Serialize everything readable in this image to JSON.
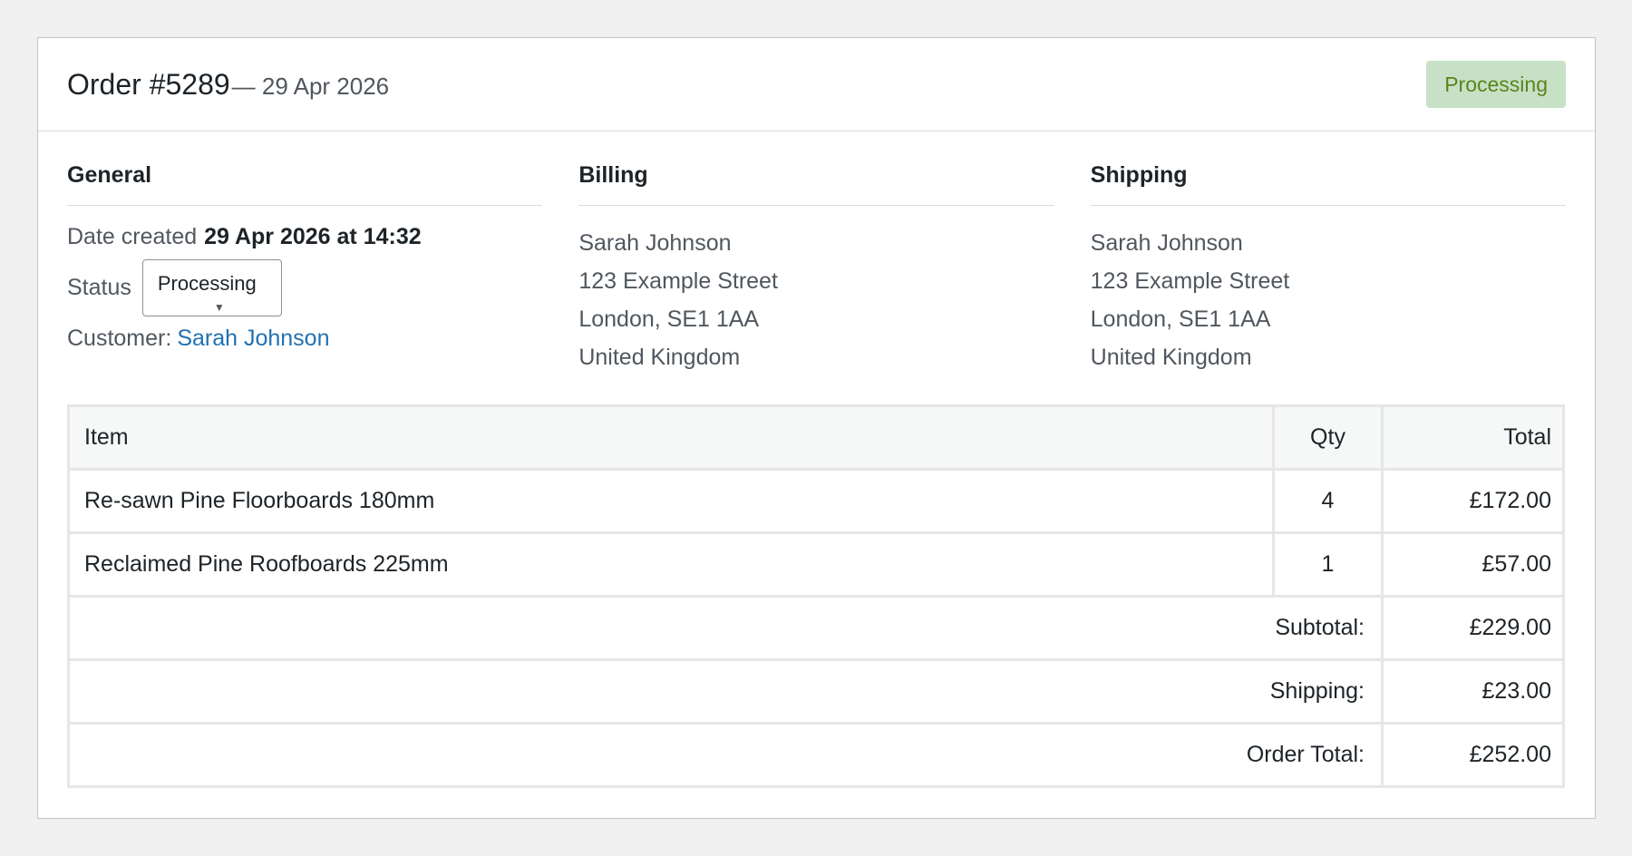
{
  "header": {
    "order_title": "Order #5289",
    "order_date": "— 29 Apr 2026",
    "status_badge": "Processing",
    "badge_bg": "#c6e1c6",
    "badge_fg": "#5b841b"
  },
  "general": {
    "title": "General",
    "date_label": "Date created",
    "date_value": "29 Apr 2026 at 14:32",
    "status_label": "Status",
    "status_value": "Processing",
    "customer_label": "Customer:",
    "customer_name": "Sarah Johnson"
  },
  "billing": {
    "title": "Billing",
    "lines": [
      "Sarah Johnson",
      "123 Example Street",
      "London, SE1 1AA",
      "United Kingdom"
    ]
  },
  "shipping": {
    "title": "Shipping",
    "lines": [
      "Sarah Johnson",
      "123 Example Street",
      "London, SE1 1AA",
      "United Kingdom"
    ]
  },
  "table": {
    "headers": {
      "item": "Item",
      "qty": "Qty",
      "total": "Total"
    },
    "rows": [
      {
        "item": "Re-sawn Pine Floorboards 180mm",
        "qty": "4",
        "total": "£172.00"
      },
      {
        "item": "Reclaimed Pine Roofboards 225mm",
        "qty": "1",
        "total": "£57.00"
      }
    ],
    "summary": [
      {
        "label": "Subtotal:",
        "value": "£229.00"
      },
      {
        "label": "Shipping:",
        "value": "£23.00"
      },
      {
        "label": "Order Total:",
        "value": "£252.00"
      }
    ]
  },
  "colors": {
    "link": "#2271b1",
    "text": "#1d2327",
    "muted": "#50575e"
  }
}
